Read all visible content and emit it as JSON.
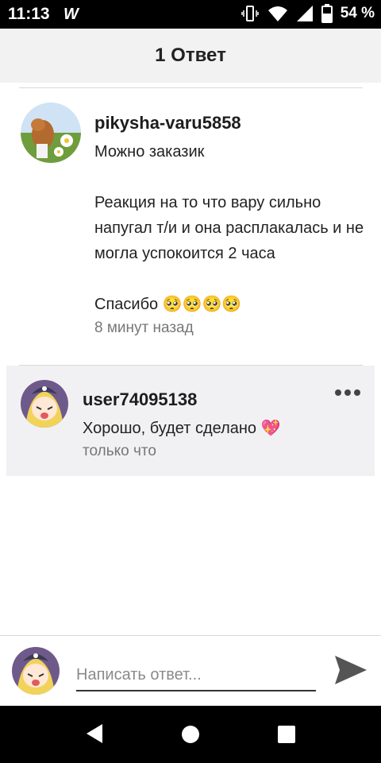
{
  "status_bar": {
    "time": "11:13",
    "app_logo": "W",
    "battery_percent": "54 %",
    "icons": [
      "vibrate-icon",
      "wifi-icon",
      "signal-icon",
      "battery-icon"
    ]
  },
  "header": {
    "title": "1 Ответ"
  },
  "comments": [
    {
      "username": "pikysha-varu5858",
      "text": "Можно заказик\n\nРеакция на то что вару сильно напугал т/и и она расплакалась и не могла успокоится 2 часа\n\nСпасибо 🥺🥺🥺🥺",
      "timestamp": "8 минут назад",
      "avatar": "dog-avatar"
    }
  ],
  "reply": {
    "username": "user74095138",
    "text": "Хорошо, будет сделано 💖",
    "timestamp": "только что",
    "avatar": "anime-avatar",
    "more_icon": "more-horizontal-icon"
  },
  "input": {
    "placeholder": "Написать ответ...",
    "value": ""
  },
  "colors": {
    "header_bg": "#f2f2f2",
    "reply_bg": "#f1f1f3",
    "accent": "#444444"
  }
}
